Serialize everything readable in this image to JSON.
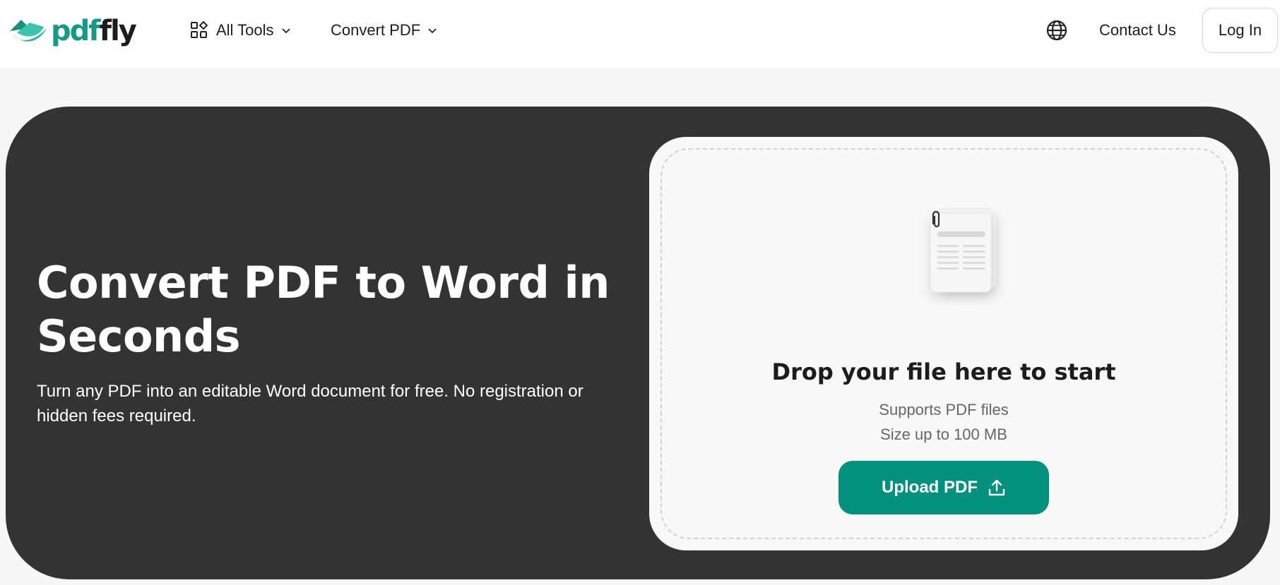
{
  "header": {
    "logo": {
      "part1": "pdf",
      "part2": "fly",
      "icon": "pdffly-logo-icon"
    },
    "nav": [
      {
        "label": "All Tools",
        "icon": "grid-icon"
      },
      {
        "label": "Convert PDF"
      }
    ],
    "language_icon": "globe-icon",
    "contact_label": "Contact Us",
    "login_label": "Log In"
  },
  "hero": {
    "title": "Convert PDF to Word in Seconds",
    "subtitle": "Turn any PDF into an editable Word document for free. No registration or hidden fees required."
  },
  "upload": {
    "title": "Drop your file here to start",
    "supports": "Supports PDF files",
    "size_limit": "Size up to 100 MB",
    "button_label": "Upload PDF",
    "button_icon": "upload-icon",
    "illustration": "document-stack-icon"
  },
  "colors": {
    "brand_teal": "#159a86",
    "button_teal": "#03907d",
    "hero_bg": "#333333",
    "page_bg": "#f7f7f7"
  }
}
